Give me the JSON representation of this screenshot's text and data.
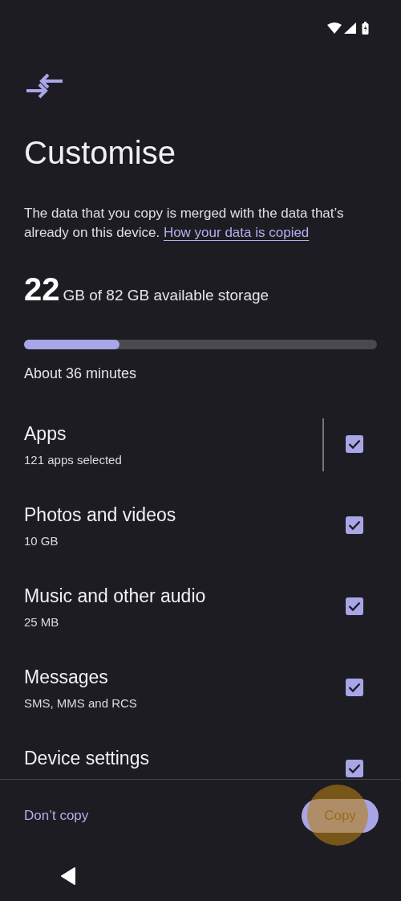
{
  "title": "Customise",
  "description": {
    "text": "The data that you copy is merged with the data that’s already on this device.",
    "link": "How your data is copied"
  },
  "storage": {
    "amount": "22",
    "detail": "GB of 82 GB available storage",
    "level": 0.27
  },
  "estimate": "About 36 minutes",
  "items": [
    {
      "title": "Apps",
      "subtitle": "121 apps selected",
      "checked": true,
      "divider": true
    },
    {
      "title": "Photos and videos",
      "subtitle": "10 GB",
      "checked": true,
      "divider": false
    },
    {
      "title": "Music and other audio",
      "subtitle": "25 MB",
      "checked": true,
      "divider": false
    },
    {
      "title": "Messages",
      "subtitle": "SMS, MMS and RCS",
      "checked": true,
      "divider": false
    },
    {
      "title": "Device settings",
      "checked": true,
      "divider": false
    }
  ],
  "buttons": {
    "secondary": "Don’t copy",
    "primary": "Copy"
  }
}
